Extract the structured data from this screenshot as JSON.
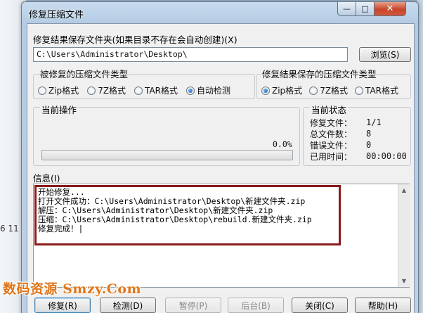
{
  "window": {
    "title": "修复压缩文件",
    "min_glyph": "—",
    "max_glyph": "□",
    "close_glyph": "✕"
  },
  "background": {
    "left_text": "6 11"
  },
  "output_folder": {
    "label": "修复结果保存文件夹(如果目录不存在会自动创建)(X)",
    "path": "C:\\Users\\Administrator\\Desktop\\",
    "browse_label": "浏览(S)"
  },
  "source_type": {
    "legend": "被修复的压缩文件类型",
    "options": [
      "Zip格式",
      "7Z格式",
      "TAR格式",
      "自动检测"
    ],
    "selected_index": 3
  },
  "result_type": {
    "legend": "修复结果保存的压缩文件类型",
    "options": [
      "Zip格式",
      "7Z格式",
      "TAR格式"
    ],
    "selected_index": 0
  },
  "current_operation": {
    "legend": "当前操作",
    "percent_text": "0.0%",
    "progress_fraction": 0.0
  },
  "current_status": {
    "legend": "当前状态",
    "rows": [
      {
        "key": "修复文件：",
        "value": "1/1"
      },
      {
        "key": "总文件数：",
        "value": "8"
      },
      {
        "key": "错误文件：",
        "value": "0"
      },
      {
        "key": "已用时间：",
        "value": "00:00:00"
      }
    ]
  },
  "info": {
    "label": "信息(I)",
    "lines": [
      "开始修复...",
      "打开文件成功：C:\\Users\\Administrator\\Desktop\\新建文件夹.zip",
      "解压：C:\\Users\\Administrator\\Desktop\\新建文件夹.zip",
      "压缩：C:\\Users\\Administrator\\Desktop\\rebuild.新建文件夹.zip",
      "修复完成！|"
    ]
  },
  "buttons": {
    "repair": "修复(R)",
    "check": "检测(D)",
    "pause": "暂停(P)",
    "background": "后台(B)",
    "close": "关闭(C)",
    "help": "帮助(H)"
  },
  "watermark": {
    "text": "数码资源 Smzy.Com"
  },
  "colors": {
    "highlight_border": "#8b1a1a",
    "watermark": "#e0761a",
    "close_button": "#c8442a"
  }
}
